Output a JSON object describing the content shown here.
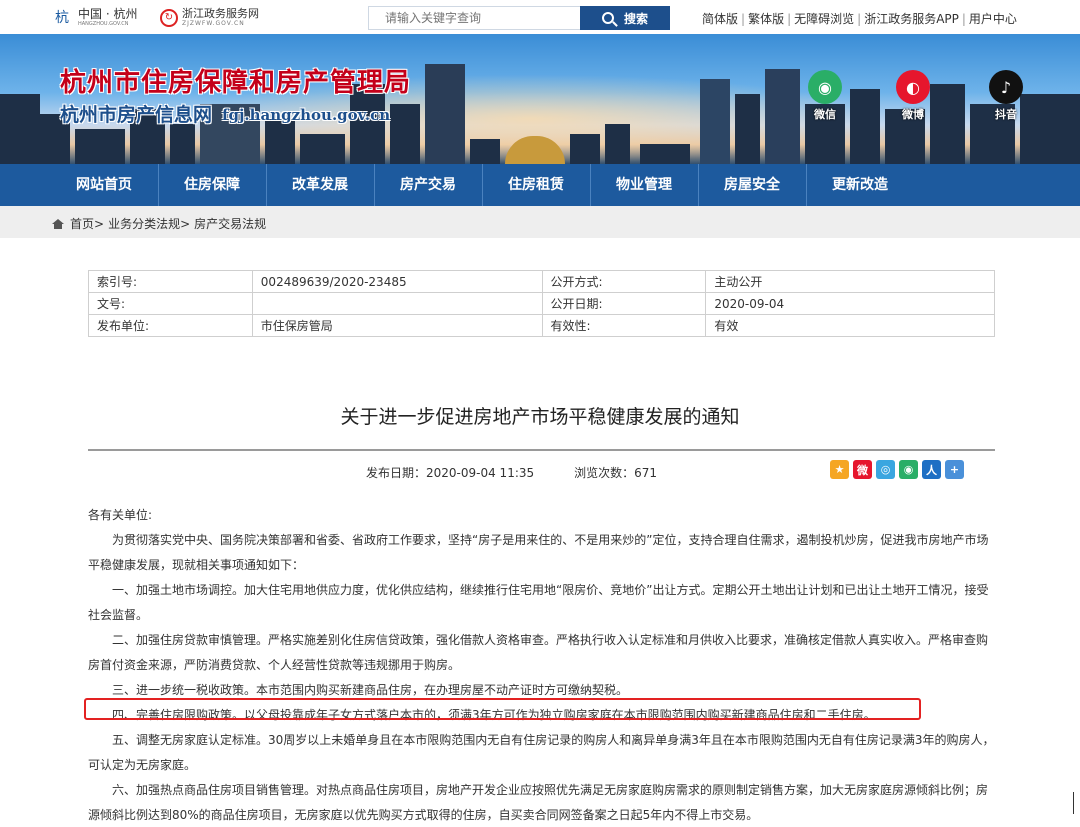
{
  "topbar": {
    "logo1": {
      "big": "中国 · 杭州",
      "small": "HANGZHOU.GOV.CN"
    },
    "logo2": {
      "big": "浙江政务服务网",
      "small": "ZJZWFW.GOV.CN"
    },
    "search_placeholder": "请输入关键字查询",
    "search_label": "搜索",
    "links": [
      "简体版",
      "繁体版",
      "无障碍浏览",
      "浙江政务服务APP",
      "用户中心"
    ]
  },
  "banner": {
    "title": "杭州市住房保障和房产管理局",
    "subtitle": "杭州市房产信息网",
    "url": "fgj.hangzhou.gov.cn",
    "social": [
      {
        "label": "微信",
        "icon": "wechat-icon",
        "color": "#2aae67"
      },
      {
        "label": "微博",
        "icon": "weibo-icon",
        "color": "#e6162d"
      },
      {
        "label": "抖音",
        "icon": "douyin-icon",
        "color": "#111111"
      }
    ]
  },
  "nav": [
    "网站首页",
    "住房保障",
    "改革发展",
    "房产交易",
    "住房租赁",
    "物业管理",
    "房屋安全",
    "更新改造"
  ],
  "breadcrumb": [
    "首页>",
    "业务分类法规>",
    "房产交易法规"
  ],
  "meta": [
    [
      "索引号:",
      "002489639/2020-23485",
      "公开方式:",
      "主动公开"
    ],
    [
      "文号:",
      "",
      "公开日期:",
      "2020-09-04"
    ],
    [
      "发布单位:",
      "市住保房管局",
      "有效性:",
      "有效"
    ]
  ],
  "article": {
    "title": "关于进一步促进房地产市场平稳健康发展的通知",
    "publish_date": "发布日期：2020-09-04 11:35",
    "views": "浏览次数：671",
    "salutation": "各有关单位:",
    "paragraphs": [
      "为贯彻落实党中央、国务院决策部署和省委、省政府工作要求，坚持“房子是用来住的、不是用来炒的”定位，支持合理自住需求，遏制投机炒房，促进我市房地产市场平稳健康发展，现就相关事项通知如下：",
      "一、加强土地市场调控。加大住宅用地供应力度，优化供应结构，继续推行住宅用地“限房价、竞地价”出让方式。定期公开土地出让计划和已出让土地开工情况，接受社会监督。",
      "二、加强住房贷款审慎管理。严格实施差别化住房信贷政策，强化借款人资格审查。严格执行收入认定标准和月供收入比要求，准确核定借款人真实收入。严格审查购房首付资金来源，严防消费贷款、个人经营性贷款等违规挪用于购房。",
      "三、进一步统一税收政策。本市范围内购买新建商品住房，在办理房屋不动产证时方可缴纳契税。",
      "四、完善住房限购政策。以父母投靠成年子女方式落户本市的，须满3年方可作为独立购房家庭在本市限购范围内购买新建商品住房和二手住房。",
      "五、调整无房家庭认定标准。30周岁以上未婚单身且在本市限购范围内无自有住房记录的购房人和离异单身满3年且在本市限购范围内无自有住房记录满3年的购房人，可认定为无房家庭。",
      "六、加强热点商品住房项目销售管理。对热点商品住房项目，房地产开发企业应按照优先满足无房家庭购房需求的原则制定销售方案，加大无房家庭房源倾斜比例；房源倾斜比例达到80%的商品住房项目，无房家庭以优先购买方式取得的住房，自买卖合同网签备案之日起5年内不得上市交易。"
    ]
  },
  "share_icons": [
    {
      "icon": "qzone-icon",
      "color": "#f5a623",
      "glyph": "★"
    },
    {
      "icon": "weibo-icon",
      "color": "#e6162d",
      "glyph": "微"
    },
    {
      "icon": "tencent-weibo-icon",
      "color": "#3aa6e0",
      "glyph": "◎"
    },
    {
      "icon": "wechat-icon",
      "color": "#2aae67",
      "glyph": "◉"
    },
    {
      "icon": "renren-icon",
      "color": "#1e6fc4",
      "glyph": "人"
    },
    {
      "icon": "more-icon",
      "color": "#4a90d9",
      "glyph": "+"
    }
  ]
}
